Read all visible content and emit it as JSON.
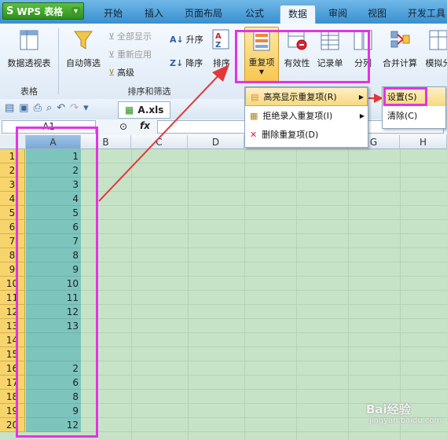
{
  "app": {
    "name": "WPS 表格",
    "logo_letter": "S",
    "menu_arrow": "▾"
  },
  "tabs": [
    "开始",
    "插入",
    "页面布局",
    "公式",
    "数据",
    "审阅",
    "视图",
    "开发工具"
  ],
  "active_tab": "数据",
  "ribbon": {
    "pivot": "数据透视表",
    "autofilter": "自动筛选",
    "show_all": "全部显示",
    "reapply": "重新应用",
    "advanced": "高级",
    "sort_asc": "升序",
    "sort_desc": "降序",
    "sort": "排序",
    "duplicates": "重复项",
    "validity": "有效性",
    "record": "记录单",
    "split": "分列",
    "consolidate": "合并计算",
    "simulate": "模拟分",
    "group_table": "表格",
    "group_sort_filter": "排序和筛选"
  },
  "qat": {
    "file_name": "A.xls"
  },
  "formula_bar": {
    "name_box": "A1",
    "fx": "fx"
  },
  "columns": [
    "A",
    "B",
    "C",
    "D",
    "G",
    "H"
  ],
  "rows": [
    "1",
    "2",
    "3",
    "4",
    "5",
    "6",
    "7",
    "8",
    "9",
    "10",
    "11",
    "12",
    "13",
    "14",
    "15",
    "16",
    "17",
    "18",
    "19",
    "20"
  ],
  "cells_A": [
    "1",
    "2",
    "3",
    "4",
    "5",
    "6",
    "7",
    "8",
    "9",
    "10",
    "11",
    "12",
    "13",
    "",
    "",
    "2",
    "6",
    "8",
    "9",
    "12"
  ],
  "menu_duplicates": {
    "highlight": "高亮显示重复项(R)",
    "reject": "拒绝录入重复项(I)",
    "delete": "删除重复项(D)"
  },
  "submenu": {
    "settings": "设置(S)",
    "clear": "清除(C)"
  },
  "watermark": "Bai经验",
  "watermark_url": "jingyan.baidu.com",
  "colors": {
    "highlight": "#e433e4",
    "arrow": "#e2383a",
    "cell_fill": "#7dc4bd",
    "row_header": "#f7d56c"
  }
}
